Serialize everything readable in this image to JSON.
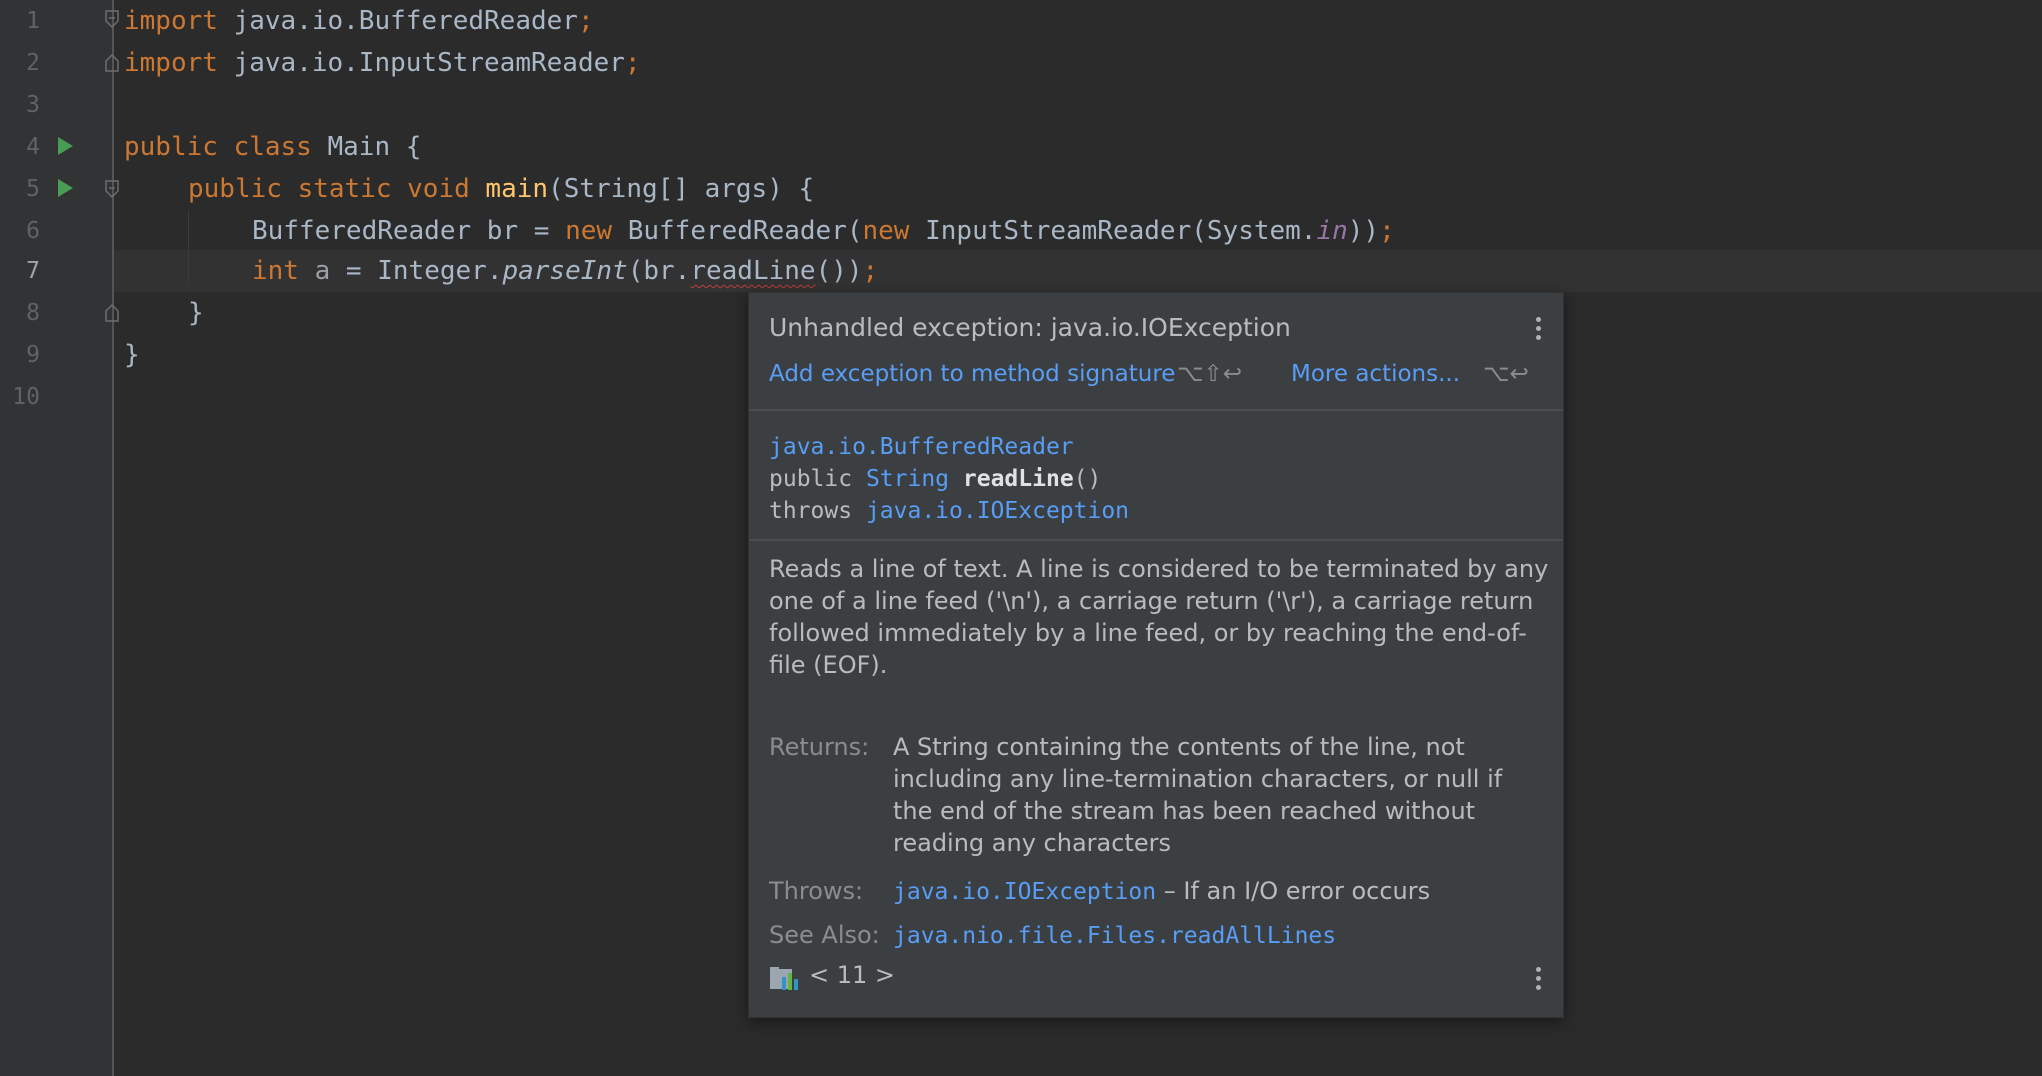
{
  "editor": {
    "active_line": 7,
    "lines": [
      {
        "num": "1"
      },
      {
        "num": "2"
      },
      {
        "num": "3"
      },
      {
        "num": "4"
      },
      {
        "num": "5"
      },
      {
        "num": "6"
      },
      {
        "num": "7"
      },
      {
        "num": "8"
      },
      {
        "num": "9"
      },
      {
        "num": "10"
      }
    ],
    "code": {
      "l1_kw": "import",
      "l1_rest": " java.io.BufferedReader",
      "l1_semi": ";",
      "l2_kw": "import",
      "l2_rest": " java.io.InputStreamReader",
      "l2_semi": ";",
      "l4_kw": "public class",
      "l4_rest": " Main {",
      "l5_kw": "public static void",
      "l5_fn": "main",
      "l5_rest": "(String[] args) {",
      "l6_a": "BufferedReader br = ",
      "l6_new1": "new",
      "l6_b": " BufferedReader(",
      "l6_new2": "new",
      "l6_c": " InputStreamReader(System.",
      "l6_in": "in",
      "l6_d": "))",
      "l6_semi": ";",
      "l7_kw": "int",
      "l7_var": "a",
      "l7_a": " = Integer.",
      "l7_parse": "parseInt",
      "l7_b": "(br.",
      "l7_err": "readLine",
      "l7_c": "())",
      "l7_semi": ";",
      "l8": "}",
      "l9": "}"
    }
  },
  "popup": {
    "error_title": "Unhandled exception: java.io.IOException",
    "fix_action": "Add exception to method signature",
    "fix_shortcut": "⌥⇧↩",
    "more_actions": "More actions...",
    "more_shortcut": "⌥↩",
    "sig_class": "java.io.BufferedReader",
    "sig_public": "public ",
    "sig_type": "String",
    "sig_method": "readLine",
    "sig_parens": "()",
    "sig_throws": "throws ",
    "sig_exception": "java.io.IOException",
    "description": "Reads a line of text. A line is considered to be terminated by any one of a line feed ('\\n'), a carriage return ('\\r'), a carriage return followed immediately by a line feed, or by reaching the end-of-file (EOF).",
    "returns_label": "Returns:",
    "returns_text": "A String containing the contents of the line, not including any line-termination characters, or null if the end of the stream has been reached without reading any characters",
    "throws_label": "Throws:",
    "throws_link": "java.io.IOException",
    "throws_text": " – If an I/O error occurs",
    "see_also_label": "See Also:",
    "see_also_link": "java.nio.file.Files.readAllLines",
    "footer_version": "< 11 >"
  },
  "colors": {
    "background": "#2b2b2b",
    "keyword": "#cc7832",
    "function": "#ffc66d",
    "static_field": "#9876aa",
    "link": "#589df6",
    "run_icon": "#499c54",
    "error_underline": "#bc3f3c"
  }
}
